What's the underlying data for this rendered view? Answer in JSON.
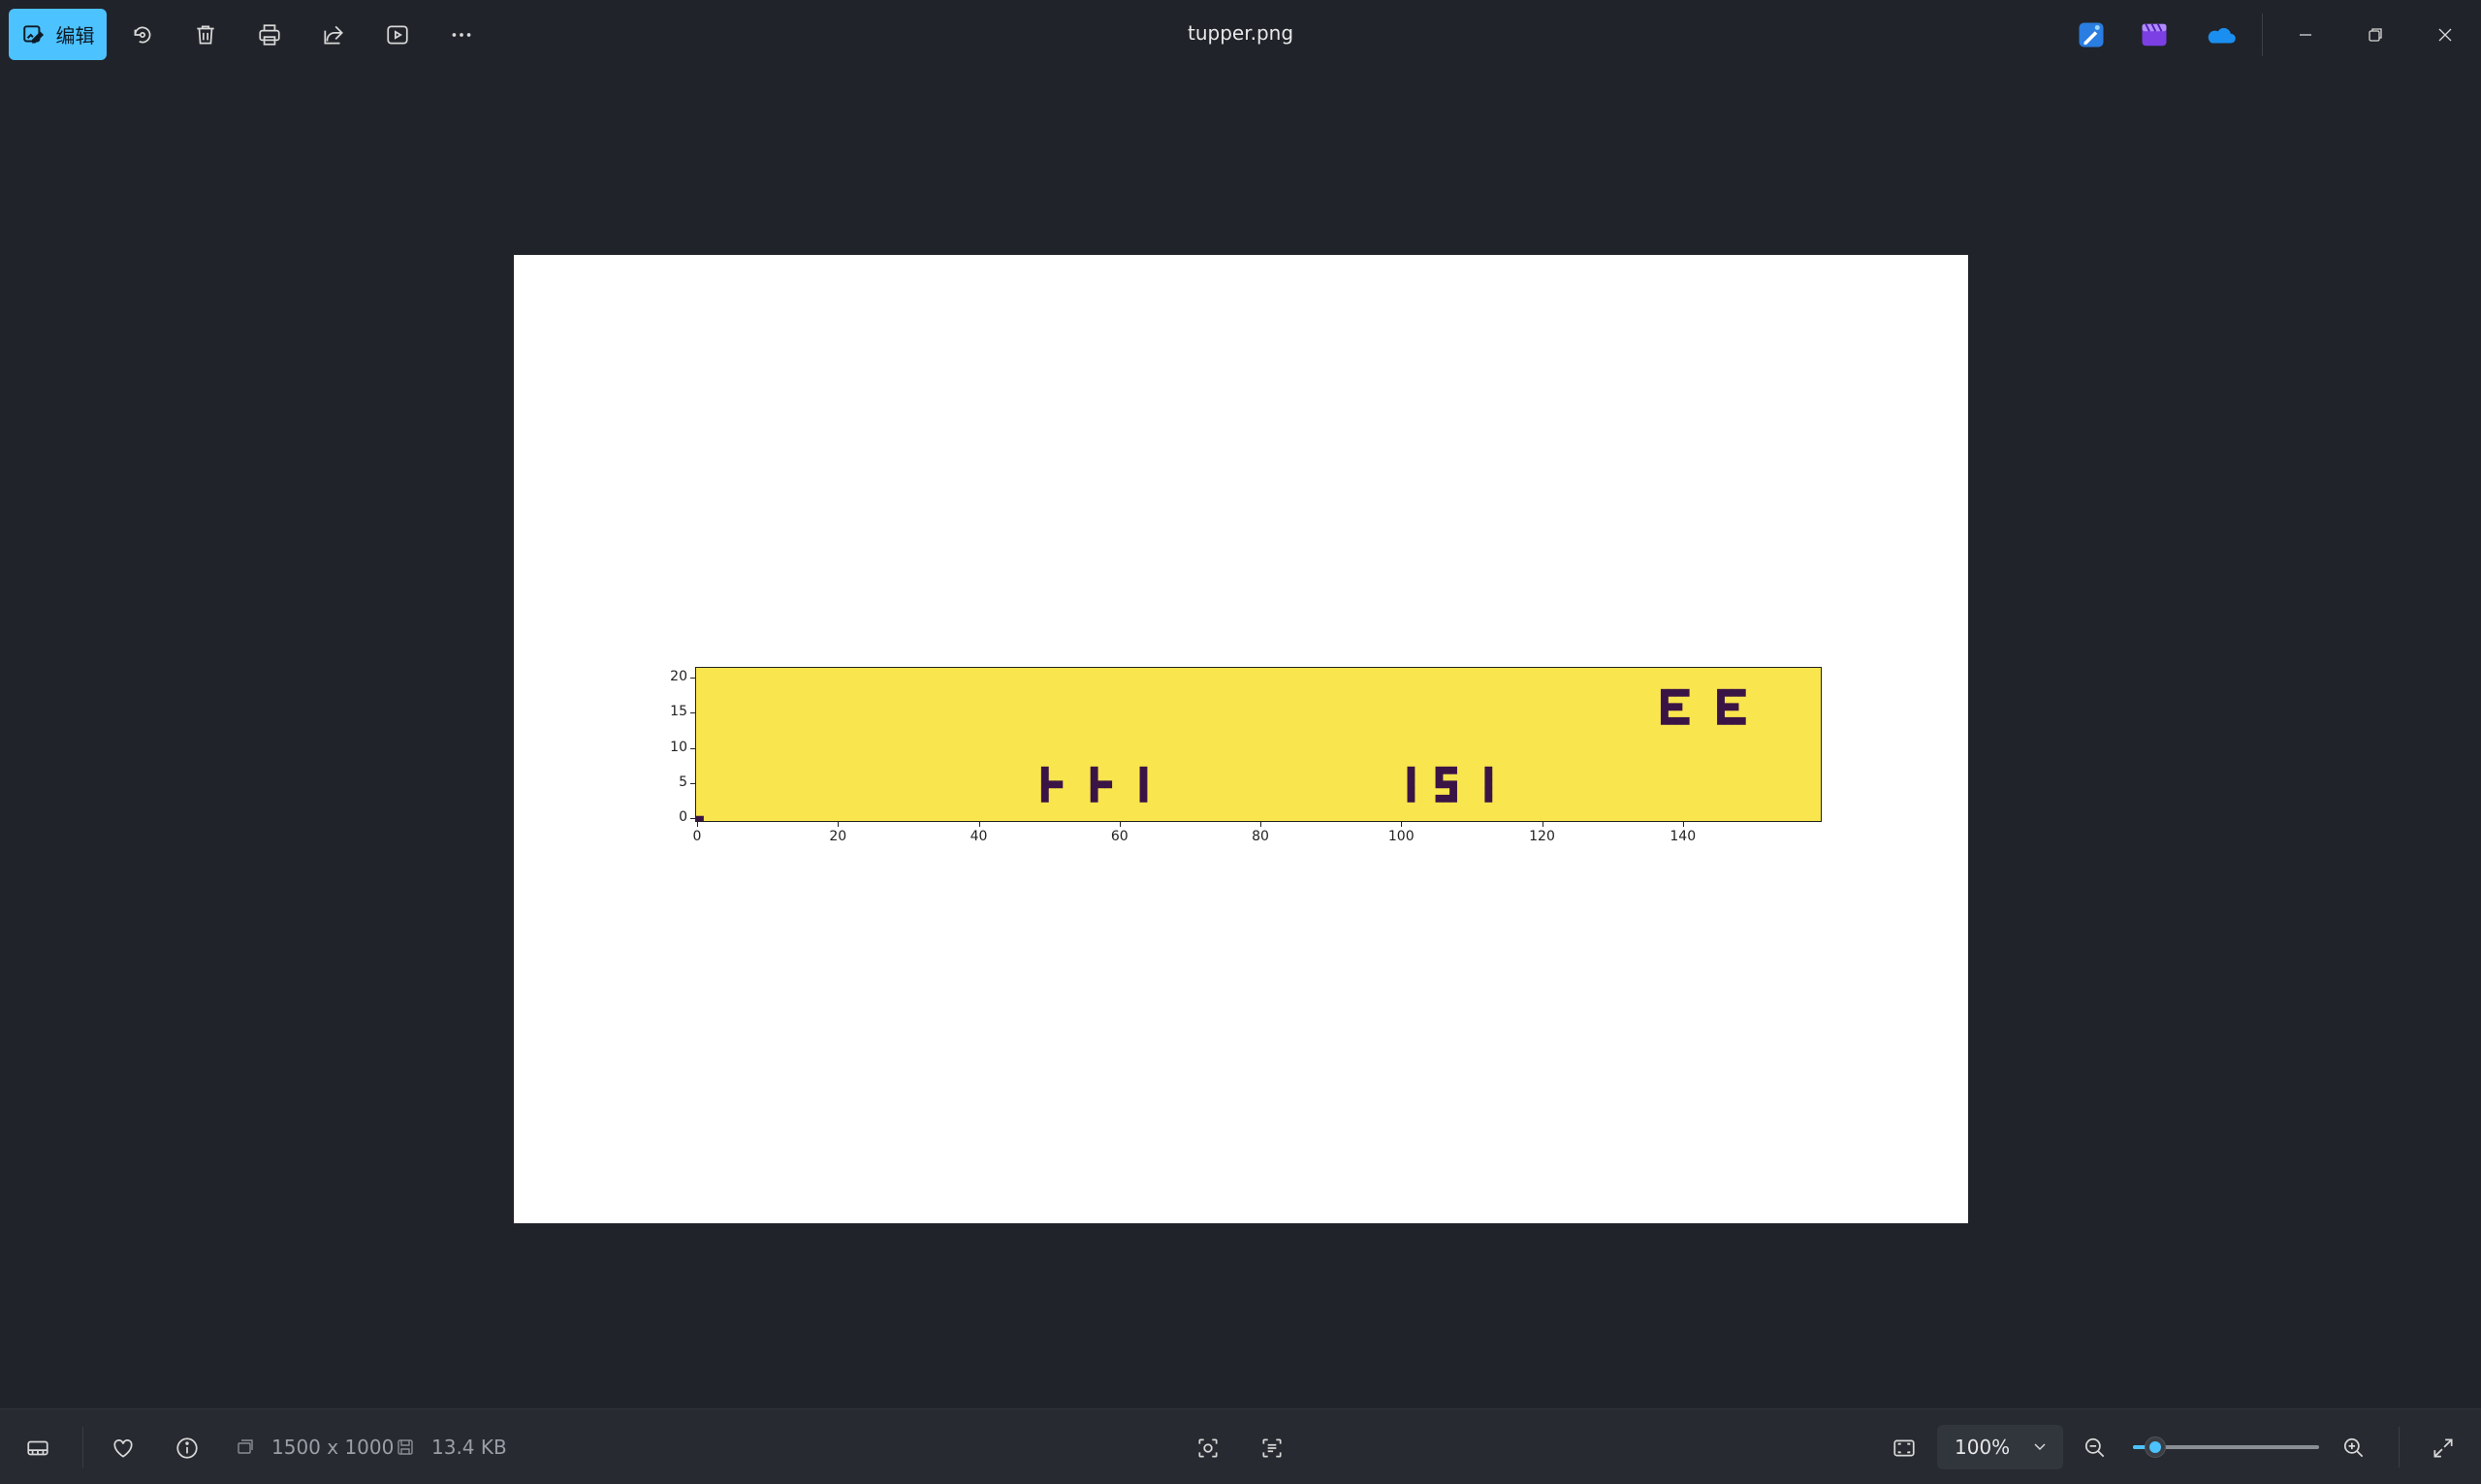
{
  "window": {
    "title": "tupper.png"
  },
  "toolbar": {
    "edit_label": "编辑",
    "tools": [
      "rotate-icon",
      "delete-icon",
      "print-icon",
      "share-icon",
      "slideshow-icon",
      "more-icon"
    ]
  },
  "apps": [
    "photo-editor-icon",
    "clipchamp-icon",
    "onedrive-icon"
  ],
  "window_controls": [
    "minimize-icon",
    "restore-icon",
    "close-icon"
  ],
  "status": {
    "dimensions": "1500 x 1000",
    "file_size": "13.4 KB",
    "zoom": "100%",
    "zoom_fraction": 0.12
  },
  "chart_data": {
    "type": "heatmap",
    "xlim": [
      0,
      160
    ],
    "ylim": [
      0,
      22
    ],
    "xticks": [
      "0",
      "20",
      "40",
      "60",
      "80",
      "100",
      "120",
      "140"
    ],
    "yticks": [
      "0",
      "5",
      "10",
      "15",
      "20"
    ],
    "colors": {
      "background": "#f9e54e",
      "foreground": "#3b1446"
    },
    "dark_cells": [
      [
        0,
        0
      ],
      [
        49,
        3
      ],
      [
        49,
        4
      ],
      [
        49,
        5
      ],
      [
        49,
        6
      ],
      [
        49,
        7
      ],
      [
        50,
        5
      ],
      [
        51,
        5
      ],
      [
        56,
        3
      ],
      [
        56,
        4
      ],
      [
        56,
        5
      ],
      [
        56,
        6
      ],
      [
        56,
        7
      ],
      [
        57,
        5
      ],
      [
        58,
        5
      ],
      [
        63,
        3
      ],
      [
        63,
        4
      ],
      [
        63,
        5
      ],
      [
        63,
        6
      ],
      [
        63,
        7
      ],
      [
        101,
        3
      ],
      [
        101,
        4
      ],
      [
        101,
        5
      ],
      [
        101,
        6
      ],
      [
        101,
        7
      ],
      [
        105,
        3
      ],
      [
        106,
        3
      ],
      [
        107,
        3
      ],
      [
        107,
        4
      ],
      [
        107,
        5
      ],
      [
        106,
        5
      ],
      [
        105,
        5
      ],
      [
        105,
        6
      ],
      [
        105,
        7
      ],
      [
        106,
        7
      ],
      [
        107,
        7
      ],
      [
        112,
        3
      ],
      [
        112,
        4
      ],
      [
        112,
        5
      ],
      [
        112,
        6
      ],
      [
        112,
        7
      ],
      [
        137,
        14
      ],
      [
        137,
        15
      ],
      [
        137,
        16
      ],
      [
        137,
        17
      ],
      [
        137,
        18
      ],
      [
        138,
        14
      ],
      [
        139,
        14
      ],
      [
        140,
        14
      ],
      [
        138,
        16
      ],
      [
        139,
        16
      ],
      [
        138,
        18
      ],
      [
        139,
        18
      ],
      [
        140,
        18
      ],
      [
        145,
        14
      ],
      [
        145,
        15
      ],
      [
        145,
        16
      ],
      [
        145,
        17
      ],
      [
        145,
        18
      ],
      [
        146,
        14
      ],
      [
        147,
        14
      ],
      [
        148,
        14
      ],
      [
        146,
        16
      ],
      [
        147,
        16
      ],
      [
        146,
        18
      ],
      [
        147,
        18
      ],
      [
        148,
        18
      ]
    ]
  }
}
